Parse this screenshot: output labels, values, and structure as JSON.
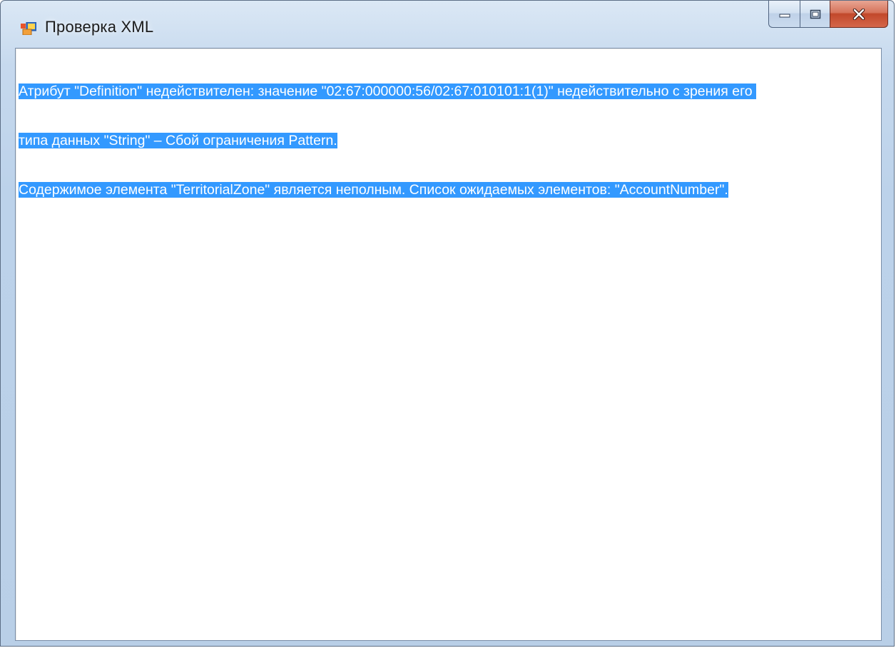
{
  "window": {
    "title": "Проверка XML"
  },
  "caption_buttons": {
    "minimize_icon": "minimize-icon",
    "maximize_icon": "maximize-icon",
    "close_icon": "close-icon"
  },
  "output": {
    "lines": [
      "Атрибут \"Definition\" недействителен: значение \"02:67:000000:56/02:67:010101:1(1)\" недействительно с зрения его ",
      "типа данных \"String\" – Сбой ограничения Pattern.",
      "Содержимое элемента \"TerritorialZone\" является неполным. Список ожидаемых элементов: \"AccountNumber\"."
    ]
  },
  "colors": {
    "selection": "#3399ff",
    "selected_text": "#ffffff"
  }
}
